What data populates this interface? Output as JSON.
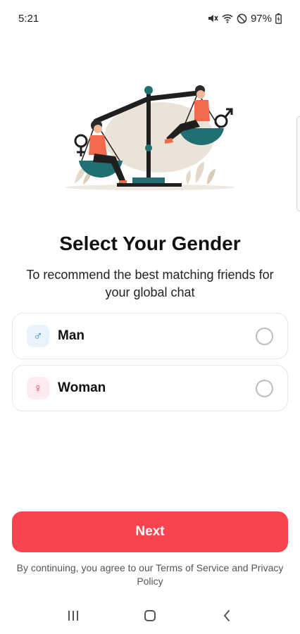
{
  "status_bar": {
    "time": "5:21",
    "battery": "97%",
    "icons": [
      "mute-icon",
      "wifi-icon",
      "do-not-disturb-icon",
      "battery-charging-icon"
    ]
  },
  "illustration": {
    "name": "gender-balance-scale",
    "colors": {
      "accent": "#f26a4b",
      "teal": "#1f6f73",
      "dark": "#1f1f1f",
      "beige": "#e9ddd0"
    }
  },
  "header": {
    "title": "Select Your Gender",
    "subtitle": "To recommend the best matching friends for your global chat"
  },
  "options": [
    {
      "label": "Man",
      "symbol": "♂",
      "icon": "male-icon",
      "selected": false
    },
    {
      "label": "Woman",
      "symbol": "♀",
      "icon": "female-icon",
      "selected": false
    }
  ],
  "footer": {
    "next_label": "Next",
    "terms_prefix": "By continuing, you agree to our ",
    "terms_link": "Terms of Service",
    "terms_and": " and ",
    "privacy_link": "Privacy Policy",
    "accent_color": "#f9434f"
  },
  "nav": {
    "icons": [
      "recent-apps-icon",
      "home-icon",
      "back-icon"
    ]
  }
}
